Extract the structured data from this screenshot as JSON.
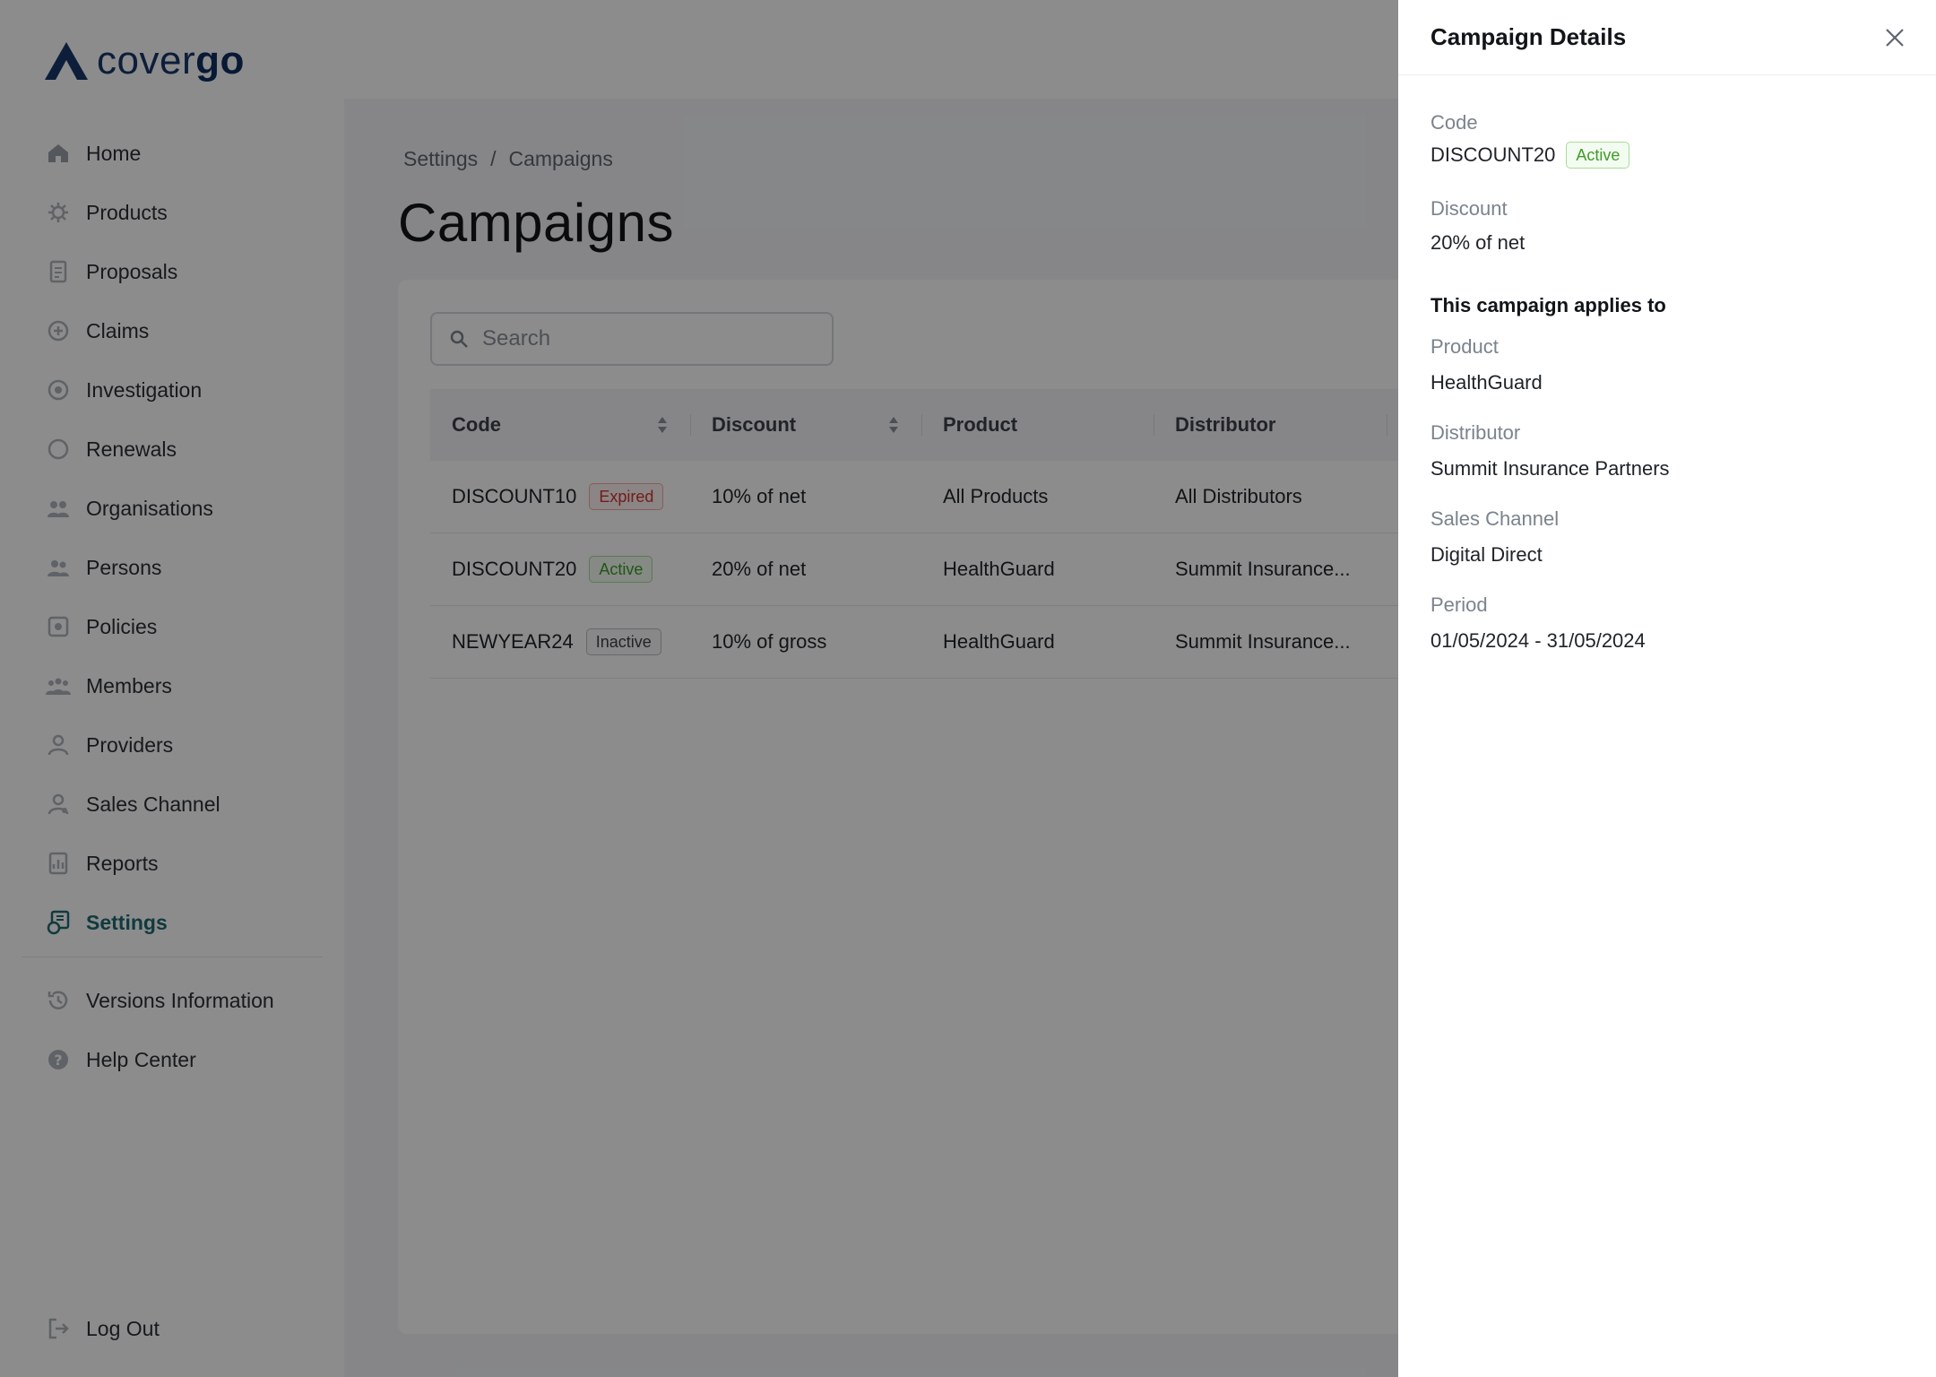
{
  "brand": {
    "name_prefix": "cover",
    "name_suffix": "go"
  },
  "sidebar": {
    "items": [
      {
        "label": "Home",
        "icon": "home-icon"
      },
      {
        "label": "Products",
        "icon": "products-icon"
      },
      {
        "label": "Proposals",
        "icon": "proposals-icon"
      },
      {
        "label": "Claims",
        "icon": "claims-icon"
      },
      {
        "label": "Investigation",
        "icon": "investigation-icon"
      },
      {
        "label": "Renewals",
        "icon": "renewals-icon"
      },
      {
        "label": "Organisations",
        "icon": "organisations-icon"
      },
      {
        "label": "Persons",
        "icon": "persons-icon"
      },
      {
        "label": "Policies",
        "icon": "policies-icon"
      },
      {
        "label": "Members",
        "icon": "members-icon"
      },
      {
        "label": "Providers",
        "icon": "providers-icon"
      },
      {
        "label": "Sales Channel",
        "icon": "sales-channel-icon"
      },
      {
        "label": "Reports",
        "icon": "reports-icon"
      },
      {
        "label": "Settings",
        "icon": "settings-icon",
        "active": true
      }
    ],
    "bottom_items": [
      {
        "label": "Versions Information",
        "icon": "history-icon"
      },
      {
        "label": "Help Center",
        "icon": "help-icon"
      }
    ],
    "logout_label": "Log Out"
  },
  "breadcrumb": {
    "parent": "Settings",
    "separator": "/",
    "current": "Campaigns"
  },
  "page_title": "Campaigns",
  "search": {
    "placeholder": "Search",
    "value": ""
  },
  "table": {
    "columns": [
      "Code",
      "Discount",
      "Product",
      "Distributor"
    ],
    "rows": [
      {
        "code": "DISCOUNT10",
        "status": "Expired",
        "discount": "10% of net",
        "product": "All Products",
        "distributor": "All Distributors"
      },
      {
        "code": "DISCOUNT20",
        "status": "Active",
        "discount": "20% of net",
        "product": "HealthGuard",
        "distributor": "Summit Insurance..."
      },
      {
        "code": "NEWYEAR24",
        "status": "Inactive",
        "discount": "10% of gross",
        "product": "HealthGuard",
        "distributor": "Summit Insurance..."
      }
    ]
  },
  "drawer": {
    "title": "Campaign Details",
    "code_label": "Code",
    "code_value": "DISCOUNT20",
    "code_status": "Active",
    "discount_label": "Discount",
    "discount_value": "20% of net",
    "applies_title": "This campaign applies to",
    "product_label": "Product",
    "product_value": "HealthGuard",
    "distributor_label": "Distributor",
    "distributor_value": "Summit Insurance Partners",
    "sales_channel_label": "Sales Channel",
    "sales_channel_value": "Digital Direct",
    "period_label": "Period",
    "period_value": "01/05/2024 - 31/05/2024"
  },
  "colors": {
    "brand": "#17386b",
    "accent": "#1f6b74",
    "active": "#3f9b2a",
    "expired": "#d0342c"
  }
}
